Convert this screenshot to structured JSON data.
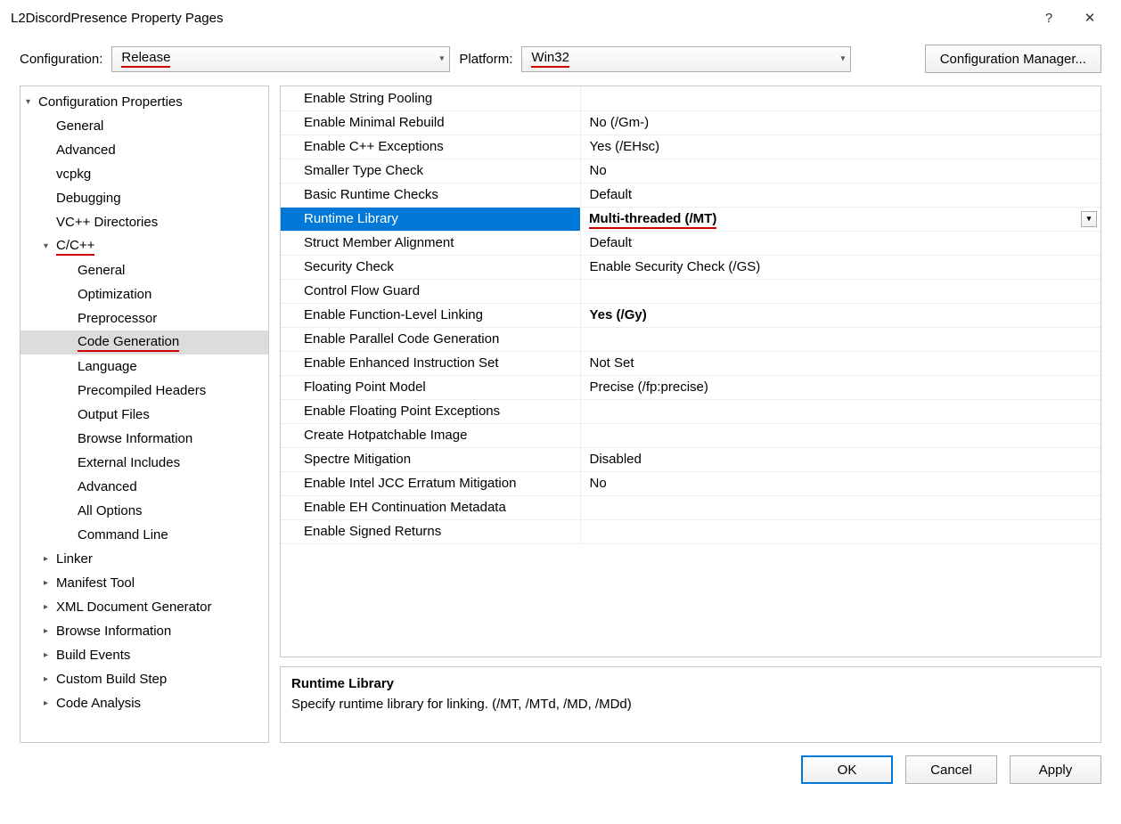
{
  "window": {
    "title": "L2DiscordPresence Property Pages",
    "help_icon": "?",
    "close_icon": "✕"
  },
  "config_row": {
    "configuration_label": "Configuration:",
    "configuration_value": "Release",
    "platform_label": "Platform:",
    "platform_value": "Win32",
    "config_manager_label": "Configuration Manager..."
  },
  "tree": [
    {
      "depth": 0,
      "expander": "▾",
      "label": "Configuration Properties",
      "selected": false
    },
    {
      "depth": 1,
      "expander": "",
      "label": "General"
    },
    {
      "depth": 1,
      "expander": "",
      "label": "Advanced"
    },
    {
      "depth": 1,
      "expander": "",
      "label": "vcpkg"
    },
    {
      "depth": 1,
      "expander": "",
      "label": "Debugging"
    },
    {
      "depth": 1,
      "expander": "",
      "label": "VC++ Directories"
    },
    {
      "depth": 1,
      "expander": "▾",
      "label": "C/C++",
      "underline": true
    },
    {
      "depth": 2,
      "expander": "",
      "label": "General"
    },
    {
      "depth": 2,
      "expander": "",
      "label": "Optimization"
    },
    {
      "depth": 2,
      "expander": "",
      "label": "Preprocessor"
    },
    {
      "depth": 2,
      "expander": "",
      "label": "Code Generation",
      "selected": true,
      "underline": true
    },
    {
      "depth": 2,
      "expander": "",
      "label": "Language"
    },
    {
      "depth": 2,
      "expander": "",
      "label": "Precompiled Headers"
    },
    {
      "depth": 2,
      "expander": "",
      "label": "Output Files"
    },
    {
      "depth": 2,
      "expander": "",
      "label": "Browse Information"
    },
    {
      "depth": 2,
      "expander": "",
      "label": "External Includes"
    },
    {
      "depth": 2,
      "expander": "",
      "label": "Advanced"
    },
    {
      "depth": 2,
      "expander": "",
      "label": "All Options"
    },
    {
      "depth": 2,
      "expander": "",
      "label": "Command Line"
    },
    {
      "depth": 1,
      "expander": "▸",
      "label": "Linker"
    },
    {
      "depth": 1,
      "expander": "▸",
      "label": "Manifest Tool"
    },
    {
      "depth": 1,
      "expander": "▸",
      "label": "XML Document Generator"
    },
    {
      "depth": 1,
      "expander": "▸",
      "label": "Browse Information"
    },
    {
      "depth": 1,
      "expander": "▸",
      "label": "Build Events"
    },
    {
      "depth": 1,
      "expander": "▸",
      "label": "Custom Build Step"
    },
    {
      "depth": 1,
      "expander": "▸",
      "label": "Code Analysis"
    }
  ],
  "properties": [
    {
      "name": "Enable String Pooling",
      "value": ""
    },
    {
      "name": "Enable Minimal Rebuild",
      "value": "No (/Gm-)"
    },
    {
      "name": "Enable C++ Exceptions",
      "value": "Yes (/EHsc)"
    },
    {
      "name": "Smaller Type Check",
      "value": "No"
    },
    {
      "name": "Basic Runtime Checks",
      "value": "Default"
    },
    {
      "name": "Runtime Library",
      "value": "Multi-threaded (/MT)",
      "selected": true,
      "bold": true,
      "underline": true
    },
    {
      "name": "Struct Member Alignment",
      "value": "Default"
    },
    {
      "name": "Security Check",
      "value": "Enable Security Check (/GS)"
    },
    {
      "name": "Control Flow Guard",
      "value": ""
    },
    {
      "name": "Enable Function-Level Linking",
      "value": "Yes (/Gy)",
      "bold": true
    },
    {
      "name": "Enable Parallel Code Generation",
      "value": ""
    },
    {
      "name": "Enable Enhanced Instruction Set",
      "value": "Not Set"
    },
    {
      "name": "Floating Point Model",
      "value": "Precise (/fp:precise)"
    },
    {
      "name": "Enable Floating Point Exceptions",
      "value": ""
    },
    {
      "name": "Create Hotpatchable Image",
      "value": ""
    },
    {
      "name": "Spectre Mitigation",
      "value": "Disabled"
    },
    {
      "name": "Enable Intel JCC Erratum Mitigation",
      "value": "No"
    },
    {
      "name": "Enable EH Continuation Metadata",
      "value": ""
    },
    {
      "name": "Enable Signed Returns",
      "value": ""
    }
  ],
  "description": {
    "title": "Runtime Library",
    "body": "Specify runtime library for linking.     (/MT, /MTd, /MD, /MDd)"
  },
  "footer": {
    "ok": "OK",
    "cancel": "Cancel",
    "apply": "Apply"
  }
}
